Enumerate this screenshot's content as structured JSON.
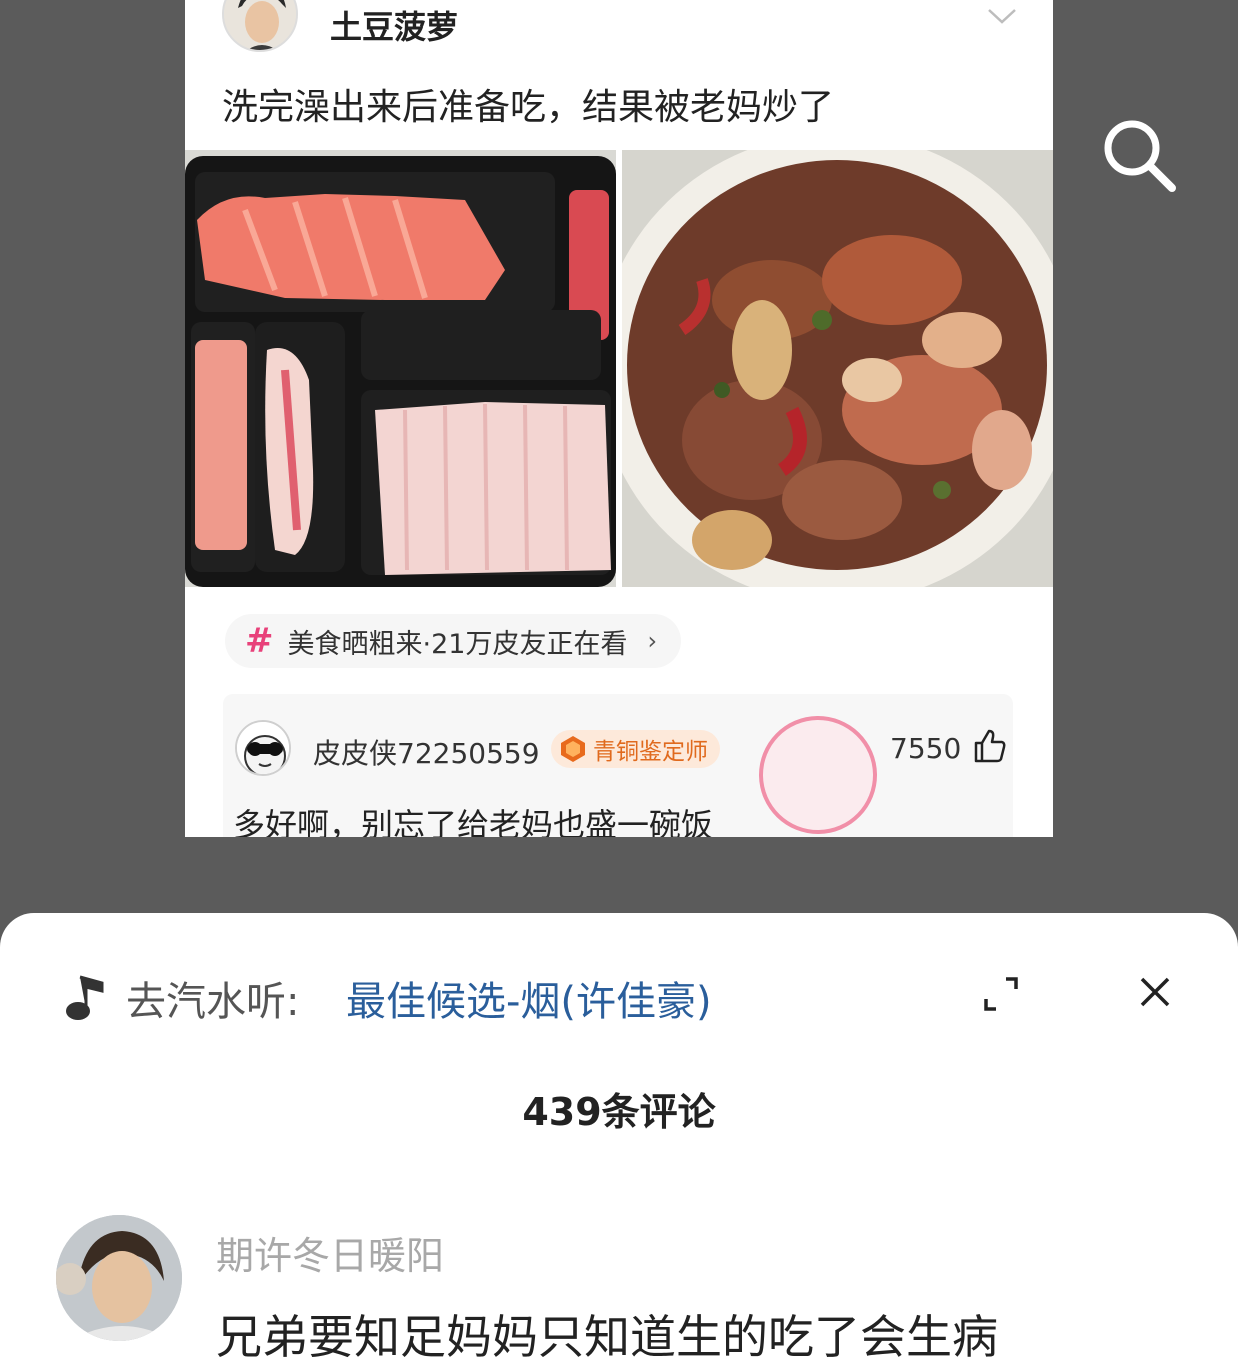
{
  "post": {
    "author": "土豆菠萝",
    "text": "洗完澡出来后准备吃，结果被老妈炒了",
    "topic": "美食晒粗来·21万皮友正在看",
    "topic_arrow": "›",
    "hot_comment": {
      "user": "皮皮侠72250559",
      "badge": "青铜鉴定师",
      "likes": "7550",
      "text": "多好啊，别忘了给老妈也盛一碗饭"
    }
  },
  "sheet": {
    "music_prefix": "去汽水听:",
    "music_title": "最佳候选-烟(许佳豪)",
    "comment_count": "439条评论",
    "first_comment": {
      "user": "期许冬日暖阳",
      "text": "兄弟要知足妈妈只知道生的吃了会生病"
    }
  },
  "colors": {
    "backdrop": "#5b5b5b",
    "link_blue": "#2a5e9b",
    "topic_pink": "#e8417a",
    "badge_orange": "#e06a1e"
  }
}
